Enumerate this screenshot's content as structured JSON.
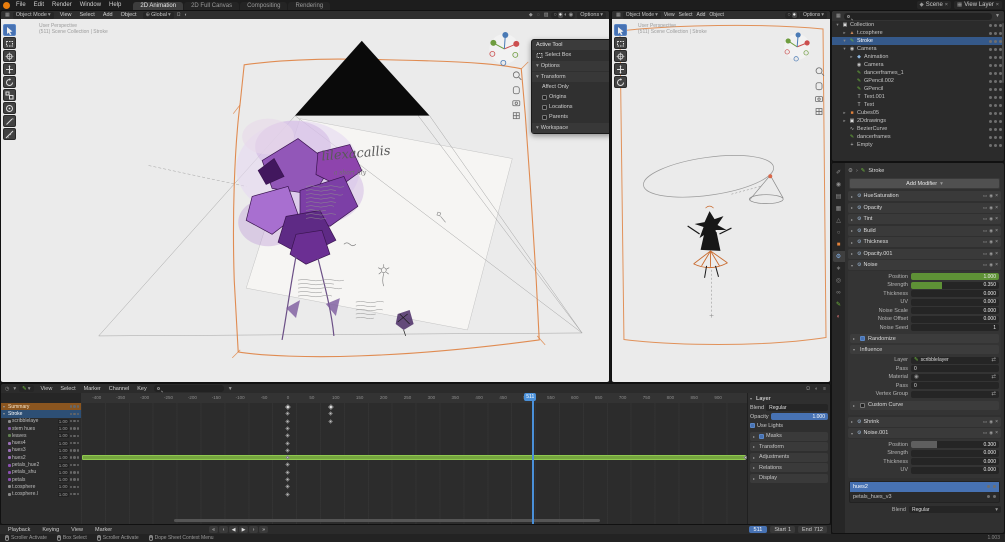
{
  "icons": {
    "caret_down": "▾",
    "caret_right": "▸",
    "close": "×",
    "funnel": "▼",
    "magnet": "Ω",
    "globe": "⊕",
    "dot": "●",
    "camera": "◉",
    "screen": "▭",
    "check": "✓",
    "pencil": "✎",
    "gear": "⚙",
    "clock": "◷",
    "grid": "▦",
    "swap": "⇄",
    "menu": "≡",
    "diamond": "◆",
    "circle": "○",
    "half": "◐",
    "solid": "●",
    "render_sphere": "◉",
    "chev": "›",
    "overlay": "◌",
    "xray": "▨"
  },
  "topbar": {
    "menus": [
      "File",
      "Edit",
      "Render",
      "Window",
      "Help"
    ],
    "tabs": [
      {
        "label": "2D Animation",
        "active": true
      },
      {
        "label": "2D Full Canvas"
      },
      {
        "label": "Compositing"
      },
      {
        "label": "Rendering"
      }
    ],
    "scene_label": "Scene",
    "view_layer_label": "View Layer"
  },
  "viewport_header": {
    "mode": "Object Mode",
    "menus": [
      "View",
      "Select",
      "Add",
      "Object"
    ],
    "orientation": "Global",
    "options": "Options"
  },
  "viewport_left": {
    "overlay_line1": "User Perspective",
    "overlay_line2": "(511) Scene Collection | Stroke",
    "drawing": {
      "title": "lilexacallis",
      "subtitle": "a short lily"
    }
  },
  "viewport_right": {
    "overlay_line1": "User Perspective",
    "overlay_line2": "(511) Scene Collection | Stroke"
  },
  "tool_panel": {
    "title": "Active Tool",
    "tool": "Select Box",
    "options": "Options",
    "transform": "Transform",
    "affect_only": "Affect Only",
    "checks": [
      {
        "label": "Origins"
      },
      {
        "label": "Locations"
      },
      {
        "label": "Parents"
      }
    ],
    "workspace": "Workspace"
  },
  "outliner": {
    "rows": [
      {
        "label": "Collection",
        "depth": 0,
        "caret": "▾",
        "glyph": "▣",
        "color": "#d8d8d8"
      },
      {
        "label": "t.cosphere",
        "depth": 1,
        "caret": "▸",
        "glyph": "▲",
        "color": "#c8875a"
      },
      {
        "label": "Stroke",
        "depth": 1,
        "caret": "▾",
        "glyph": "✎",
        "color": "#6fba3c",
        "selected": true
      },
      {
        "label": "Camera",
        "depth": 1,
        "caret": "▾",
        "glyph": "◉",
        "color": "#c8c8c8"
      },
      {
        "label": "Animation",
        "depth": 2,
        "caret": "▸",
        "glyph": "◆",
        "color": "#8fb8e0"
      },
      {
        "label": "Camera",
        "depth": 2,
        "caret": "",
        "glyph": "◉",
        "color": "#c8c8c8"
      },
      {
        "label": "dancerframes_1",
        "depth": 2,
        "caret": "",
        "glyph": "✎",
        "color": "#6fba3c"
      },
      {
        "label": "GPencil.002",
        "depth": 2,
        "caret": "",
        "glyph": "✎",
        "color": "#6fba3c"
      },
      {
        "label": "GPencil",
        "depth": 2,
        "caret": "",
        "glyph": "✎",
        "color": "#6fba3c"
      },
      {
        "label": "Text.001",
        "depth": 2,
        "caret": "",
        "glyph": "T",
        "color": "#c8c8c8"
      },
      {
        "label": "Text",
        "depth": 2,
        "caret": "",
        "glyph": "T",
        "color": "#c8c8c8"
      },
      {
        "label": "Cubes05",
        "depth": 1,
        "caret": "▸",
        "glyph": "■",
        "color": "#e0813a"
      },
      {
        "label": "2Ddrawings",
        "depth": 1,
        "caret": "▸",
        "glyph": "▣",
        "color": "#d8d8d8"
      },
      {
        "label": "BezierCurve",
        "depth": 1,
        "caret": "",
        "glyph": "∿",
        "color": "#c8c8c8"
      },
      {
        "label": "dancerframes",
        "depth": 1,
        "caret": "",
        "glyph": "✎",
        "color": "#6fba3c"
      },
      {
        "label": "Empty",
        "depth": 1,
        "caret": "",
        "glyph": "+",
        "color": "#c8c8c8"
      }
    ]
  },
  "properties": {
    "breadcrumb": "Stroke",
    "add_modifier": "Add Modifier",
    "tabs": [
      {
        "name": "tool",
        "glyph": "✐"
      },
      {
        "name": "render",
        "glyph": "◉"
      },
      {
        "name": "output",
        "glyph": "▤"
      },
      {
        "name": "view-layer",
        "glyph": "▦"
      },
      {
        "name": "scene",
        "glyph": "△"
      },
      {
        "name": "world",
        "glyph": "○"
      },
      {
        "name": "object",
        "glyph": "■",
        "color": "#e0813a"
      },
      {
        "name": "modifiers",
        "glyph": "⚙",
        "active": true
      },
      {
        "name": "particles",
        "glyph": "∗"
      },
      {
        "name": "physics",
        "glyph": "◎"
      },
      {
        "name": "constraints",
        "glyph": "∞"
      },
      {
        "name": "object-data",
        "glyph": "✎",
        "color": "#6fba3c"
      },
      {
        "name": "material",
        "glyph": "◐",
        "color": "#c46a6a"
      }
    ],
    "modifiers_top": [
      {
        "name": "HueSaturation"
      },
      {
        "name": "Opacity"
      },
      {
        "name": "Tint"
      },
      {
        "name": "Build"
      },
      {
        "name": "Thickness"
      },
      {
        "name": "Opacity.001"
      }
    ],
    "noise": {
      "name": "Noise",
      "props": [
        {
          "label": "Position",
          "value": "1.000",
          "fill": 100,
          "anim": true
        },
        {
          "label": "Strength",
          "value": "0.350",
          "fill": 35,
          "anim": true
        },
        {
          "label": "Thickness",
          "value": "0.000",
          "fill": 0
        },
        {
          "label": "UV",
          "value": "0.000",
          "fill": 0
        },
        {
          "label": "Noise Scale",
          "value": "0.000",
          "fill": 0
        },
        {
          "label": "Noise Offset",
          "value": "0.000",
          "fill": 0
        },
        {
          "label": "Noise Seed",
          "value": "1",
          "fill": 0
        }
      ],
      "randomize": "Randomize",
      "influence": "Influence",
      "layer_label": "Layer",
      "layer_value": "scribblelayer",
      "pass_label": "Pass",
      "pass_value": "0",
      "material_label": "Material",
      "material_pass_label": "Pass",
      "material_pass_value": "0",
      "vertex_group_label": "Vertex Group",
      "custom_curve": "Custom Curve"
    },
    "shrink_name": "Shrink",
    "noise2": {
      "name": "Noise.001",
      "props": [
        {
          "label": "Position",
          "value": "0.300",
          "fill": 30
        },
        {
          "label": "Strength",
          "value": "0.000",
          "fill": 0
        },
        {
          "label": "Thickness",
          "value": "0.000",
          "fill": 0
        },
        {
          "label": "UV",
          "value": "0.000",
          "fill": 0
        }
      ]
    },
    "layers_list": [
      {
        "name": "hues2",
        "selected": true
      },
      {
        "name": "petals_hues_v3"
      }
    ],
    "blend_label": "Blend",
    "blend_value": "Regular"
  },
  "dopesheet": {
    "menus": [
      "View",
      "Select",
      "Marker",
      "Channel",
      "Key"
    ],
    "ruler": {
      "start": -400,
      "end": 900,
      "step": 50
    },
    "playhead_frame": 511,
    "channels": [
      {
        "name": "Summary",
        "kind": "summary",
        "caret": "▾",
        "keys": [
          0,
          90
        ]
      },
      {
        "name": "Stroke",
        "kind": "object",
        "caret": "▾",
        "selected": true,
        "keys": [
          0,
          90
        ]
      },
      {
        "name": "scribblelaye",
        "value": "1.00",
        "color": "#8b8b8b",
        "keys": [
          0,
          90
        ]
      },
      {
        "name": "stem hues",
        "value": "1.00",
        "color": "#7f5aa0",
        "keys": [
          0
        ]
      },
      {
        "name": "leaves",
        "value": "1.00",
        "color": "#5f7f4f",
        "keys": [
          0
        ]
      },
      {
        "name": "hues4",
        "value": "1.00",
        "color": "#9a6fb8",
        "keys": [
          0
        ]
      },
      {
        "name": "hues3",
        "value": "1.00",
        "color": "#9a6fb8",
        "keys": [
          0
        ]
      },
      {
        "name": "hues2",
        "value": "1.00",
        "color": "#9a6fb8",
        "keys": [
          0,
          958
        ],
        "bar": [
          -430,
          958
        ]
      },
      {
        "name": "petals_hue2",
        "value": "1.00",
        "color": "#8a4fb0",
        "keys": [
          0
        ]
      },
      {
        "name": "petals_shu",
        "value": "1.00",
        "color": "#8a4fb0",
        "keys": [
          0
        ]
      },
      {
        "name": "petals",
        "value": "1.00",
        "color": "#8a4fb0",
        "keys": [
          0
        ]
      },
      {
        "name": "t.cosphere",
        "value": "1.00",
        "color": "#888888",
        "keys": [
          0
        ]
      },
      {
        "name": "t.cosphere.l",
        "value": "1.00",
        "color": "#888888",
        "keys": [
          0
        ]
      }
    ],
    "layer_panel": {
      "title": "Layer",
      "blend_label": "Blend",
      "blend_value": "Regular",
      "opacity_label": "Opacity",
      "opacity_value": "1.000",
      "use_lights": "Use Lights",
      "sections": [
        {
          "label": "Masks",
          "check": true
        },
        {
          "label": "Transform"
        },
        {
          "label": "Adjustments"
        },
        {
          "label": "Relations"
        },
        {
          "label": "Display"
        }
      ]
    }
  },
  "playback": {
    "menus": [
      "Playback",
      "Keying",
      "View",
      "Marker"
    ],
    "transport": [
      {
        "glyph": "«",
        "name": "jump-start"
      },
      {
        "glyph": "‹",
        "name": "prev-keyframe"
      },
      {
        "glyph": "◀",
        "name": "play-reverse"
      },
      {
        "glyph": "▶",
        "name": "play"
      },
      {
        "glyph": "›",
        "name": "next-keyframe"
      },
      {
        "glyph": "»",
        "name": "jump-end"
      }
    ],
    "frame": "511",
    "start_label": "Start",
    "start": "1",
    "end_label": "End",
    "end": "712"
  },
  "statusbar": {
    "hints": [
      "Scroller Activate",
      "Box Select",
      "Scroller Activate",
      "Dope Sheet Context Menu"
    ],
    "right": "1.003"
  }
}
